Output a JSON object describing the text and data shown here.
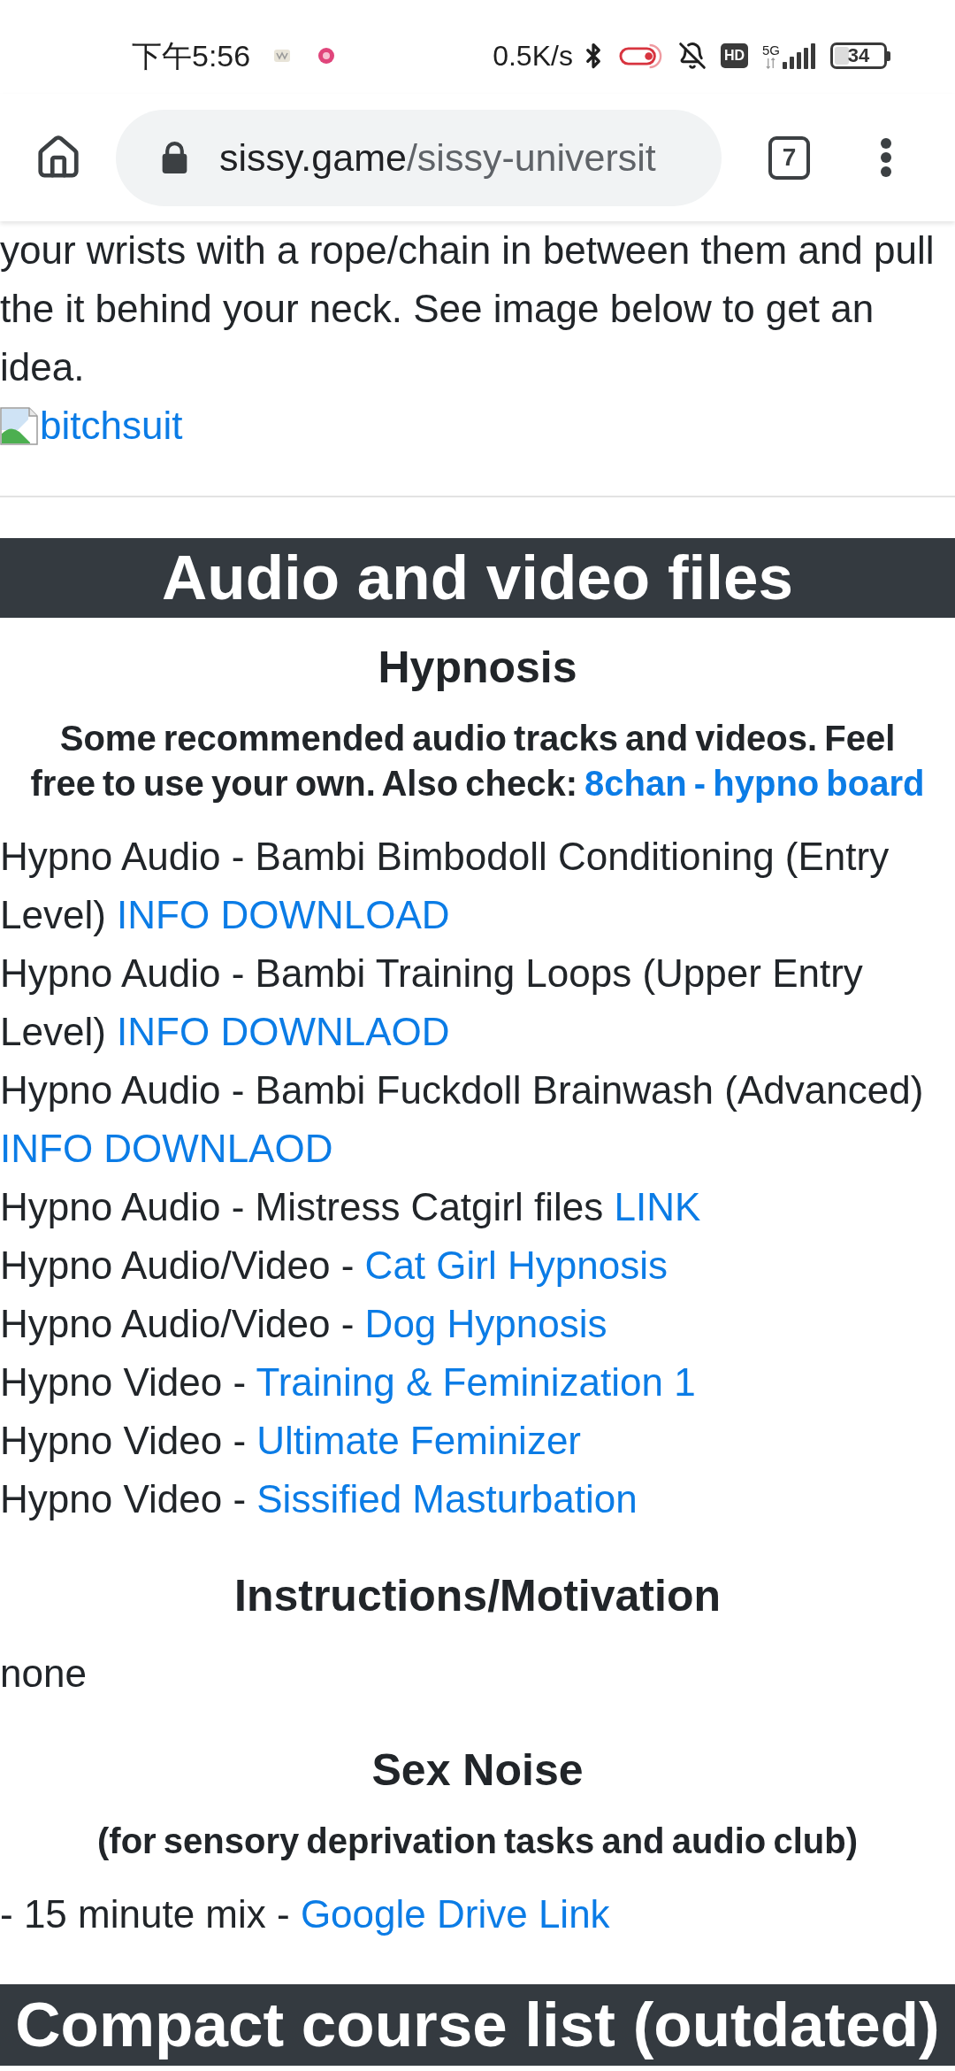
{
  "status_bar": {
    "time": "下午5:56",
    "net_speed": "0.5K/s",
    "hd_badge": "HD",
    "network": "5G",
    "battery": "34"
  },
  "toolbar": {
    "url_host": "sissy.game",
    "url_path": "/sissy-universit",
    "tab_count": "7"
  },
  "blocks": [
    {
      "kind": "entry",
      "text": "your wrists with a rope/chain in between them and pull the it behind your neck. See image below to get an idea."
    },
    {
      "kind": "image",
      "alt": "bitchsuit"
    },
    {
      "kind": "rule"
    },
    {
      "kind": "banner",
      "text": "Audio and video files"
    },
    {
      "kind": "heading",
      "text": "Hypnosis"
    },
    {
      "kind": "lead",
      "text": "Some recommended audio tracks and videos. Feel free to use your own. Also check:",
      "links": [
        "8chan - hypno board"
      ]
    },
    {
      "kind": "entry",
      "text": "Hypno Audio - Bambi Bimbodoll Conditioning (Entry Level)",
      "links": [
        "INFO",
        "DOWNLOAD"
      ]
    },
    {
      "kind": "entry",
      "text": "Hypno Audio - Bambi Training Loops (Upper Entry Level)",
      "links": [
        "INFO",
        "DOWNLAOD"
      ]
    },
    {
      "kind": "entry",
      "text": "Hypno Audio - Bambi Fuckdoll Brainwash (Advanced)",
      "links": [
        "INFO",
        "DOWNLAOD"
      ]
    },
    {
      "kind": "entry",
      "text": "Hypno Audio - Mistress Catgirl files",
      "links": [
        "LINK"
      ]
    },
    {
      "kind": "entry",
      "text": "Hypno Audio/Video -",
      "links": [
        "Cat Girl Hypnosis"
      ]
    },
    {
      "kind": "entry",
      "text": "Hypno Audio/Video -",
      "links": [
        "Dog Hypnosis"
      ]
    },
    {
      "kind": "entry",
      "text": "Hypno Video -",
      "links": [
        "Training & Feminization 1"
      ]
    },
    {
      "kind": "entry",
      "text": "Hypno Video -",
      "links": [
        "Ultimate Feminizer"
      ]
    },
    {
      "kind": "entry",
      "text": "Hypno Video -",
      "links": [
        "Sissified Masturbation"
      ]
    },
    {
      "kind": "heading",
      "text": "Instructions/Motivation"
    },
    {
      "kind": "entry",
      "text": "none"
    },
    {
      "kind": "heading",
      "text": "Sex Noise"
    },
    {
      "kind": "lead",
      "text": "(for sensory deprivation tasks and audio club)"
    },
    {
      "kind": "entry",
      "text": "- 15 minute mix -",
      "links": [
        "Google Drive Link"
      ]
    },
    {
      "kind": "banner",
      "text": "Compact course list (outdated)"
    }
  ]
}
